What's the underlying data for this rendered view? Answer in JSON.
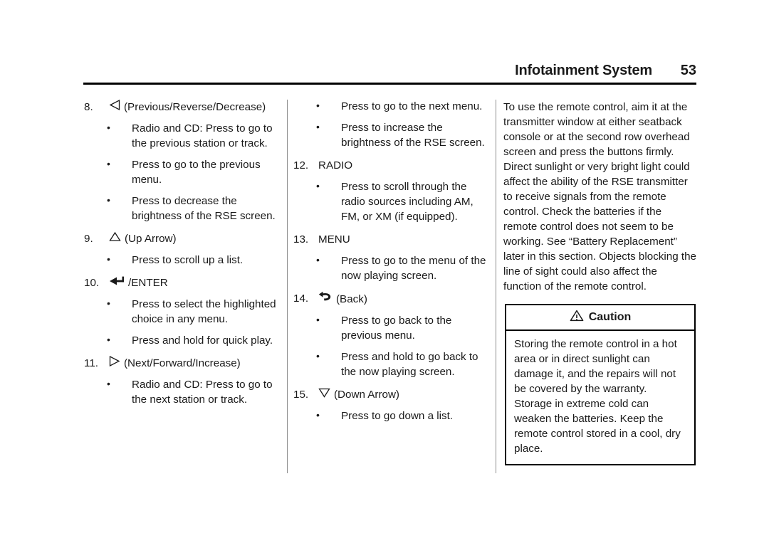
{
  "header": {
    "title": "Infotainment System",
    "page_number": "53"
  },
  "columns": {
    "left": [
      {
        "number": "8.",
        "icon": "triangle-left-outline-icon",
        "label": "(Previous/Reverse/Decrease)",
        "bullets": [
          "Radio and CD: Press to go to the previous station or track.",
          "Press to go to the previous menu.",
          "Press to decrease the brightness of the RSE screen."
        ]
      },
      {
        "number": "9.",
        "icon": "triangle-up-outline-icon",
        "label": "(Up Arrow)",
        "bullets": [
          "Press to scroll up a list."
        ]
      },
      {
        "number": "10.",
        "icon": "enter-return-arrow-icon",
        "label": "/ENTER",
        "bullets": [
          "Press to select the highlighted choice in any menu.",
          "Press and hold for quick play."
        ]
      },
      {
        "number": "11.",
        "icon": "triangle-right-outline-icon",
        "label": "(Next/Forward/Increase)",
        "bullets": [
          "Radio and CD: Press to go to the next station or track."
        ]
      }
    ],
    "middle": {
      "orphan_bullets": [
        "Press to go to the next menu.",
        "Press to increase the brightness of the RSE screen."
      ],
      "items": [
        {
          "number": "12.",
          "icon": "",
          "label": "RADIO",
          "bullets": [
            "Press to scroll through the radio sources including AM, FM, or XM (if equipped)."
          ]
        },
        {
          "number": "13.",
          "icon": "",
          "label": "MENU",
          "bullets": [
            "Press to go to the menu of the now playing screen."
          ]
        },
        {
          "number": "14.",
          "icon": "back-curved-arrow-icon",
          "label": "(Back)",
          "bullets": [
            "Press to go back to the previous menu.",
            "Press and hold to go back to the now playing screen."
          ]
        },
        {
          "number": "15.",
          "icon": "triangle-down-outline-icon",
          "label": "(Down Arrow)",
          "bullets": [
            "Press to go down a list."
          ]
        }
      ]
    },
    "right": {
      "paragraph": "To use the remote control, aim it at the transmitter window at either seatback console or at the second row overhead screen and press the buttons firmly. Direct sunlight or very bright light could affect the ability of the RSE transmitter to receive signals from the remote control. Check the batteries if the remote control does not seem to be working. See “Battery Replacement” later in this section. Objects blocking the line of sight could also affect the function of the remote control.",
      "caution": {
        "icon": "warning-triangle-icon",
        "title": "Caution",
        "body": "Storing the remote control in a hot area or in direct sunlight can damage it, and the repairs will not be covered by the warranty. Storage in extreme cold can weaken the batteries. Keep the remote control stored in a cool, dry place."
      }
    }
  },
  "colors": {
    "text": "#1a1a1a",
    "rule": "#000000",
    "divider": "#8c8c8c",
    "background": "#ffffff"
  }
}
